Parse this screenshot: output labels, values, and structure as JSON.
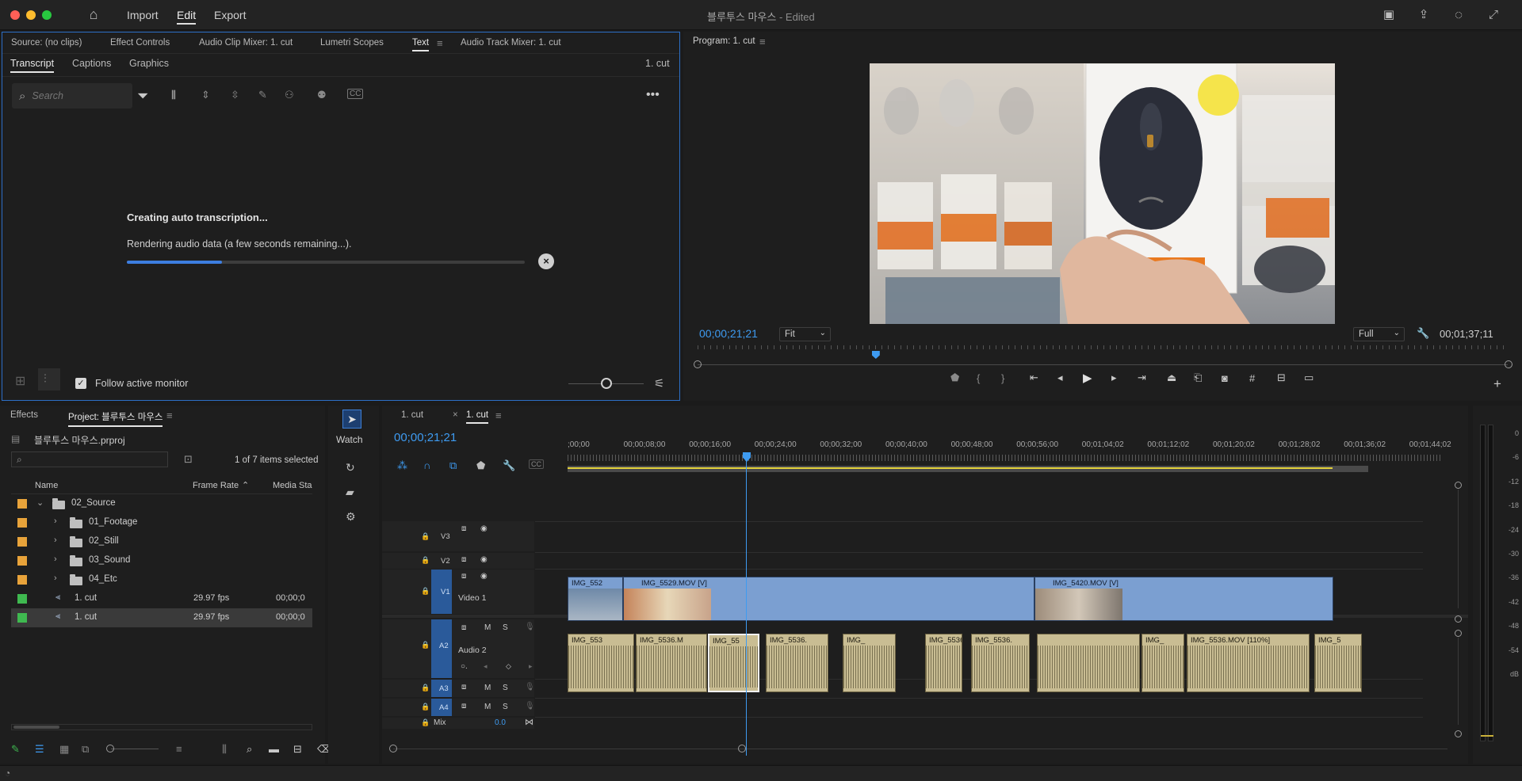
{
  "app": {
    "title": "블루투스 마우스",
    "title_suffix": " - Edited"
  },
  "menu": {
    "import": "Import",
    "edit": "Edit",
    "export": "Export"
  },
  "source_panel": {
    "tabs": [
      "Source: (no clips)",
      "Effect Controls",
      "Audio Clip Mixer: 1. cut",
      "Lumetri Scopes",
      "Text",
      "Audio Track Mixer: 1. cut"
    ],
    "subtabs": [
      "Transcript",
      "Captions",
      "Graphics"
    ],
    "sequence_label": "1. cut",
    "search_placeholder": "Search",
    "status_title": "Creating auto transcription...",
    "status_detail": "Rendering audio data (a few seconds remaining...).",
    "progress": 0.24,
    "follow_label": "Follow active monitor"
  },
  "program": {
    "title": "Program: 1. cut",
    "timecode": "00;00;21;21",
    "fit": "Fit",
    "quality": "Full",
    "duration": "00;01;37;11",
    "playhead_fraction": 0.22
  },
  "project": {
    "tabs": [
      "Effects",
      "Project: 블루투스 마우스"
    ],
    "file": "블루투스 마우스.prproj",
    "selection": "1 of 7 items selected",
    "columns": [
      "Name",
      "Frame Rate",
      "Media Star"
    ],
    "items": [
      {
        "name": "02_Source",
        "type": "folder",
        "color": "#e8a33a",
        "indent": 0,
        "expanded": true,
        "fps": "",
        "start": ""
      },
      {
        "name": "01_Footage",
        "type": "folder",
        "color": "#e8a33a",
        "indent": 1,
        "expanded": false,
        "fps": "",
        "start": ""
      },
      {
        "name": "02_Still",
        "type": "folder",
        "color": "#e8a33a",
        "indent": 1,
        "expanded": false,
        "fps": "",
        "start": ""
      },
      {
        "name": "03_Sound",
        "type": "folder",
        "color": "#e8a33a",
        "indent": 1,
        "expanded": false,
        "fps": "",
        "start": ""
      },
      {
        "name": "04_Etc",
        "type": "folder",
        "color": "#e8a33a",
        "indent": 1,
        "expanded": false,
        "fps": "",
        "start": ""
      },
      {
        "name": "1. cut",
        "type": "sequence",
        "color": "#3fb950",
        "indent": 0,
        "fps": "29.97 fps",
        "start": "00;00;0"
      },
      {
        "name": "1. cut",
        "type": "sequence",
        "color": "#3fb950",
        "indent": 0,
        "fps": "29.97 fps",
        "start": "00;00;0",
        "selected": true
      }
    ]
  },
  "tools": {
    "watch": "Watch"
  },
  "timeline": {
    "tabs": [
      "1. cut",
      "1. cut"
    ],
    "timecode": "00;00;21;21",
    "ruler": [
      ";00;00",
      "00;00;08;00",
      "00;00;16;00",
      "00;00;24;00",
      "00;00;32;00",
      "00;00;40;00",
      "00;00;48;00",
      "00;00;56;00",
      "00;01;04;02",
      "00;01;12;02",
      "00;01;20;02",
      "00;01;28;02",
      "00;01;36;02",
      "00;01;44;02"
    ],
    "tracks": {
      "v3": "V3",
      "v2": "V2",
      "v1": "V1",
      "v1_name": "Video 1",
      "a2": "A2",
      "a2_name": "Audio 2",
      "a3": "A3",
      "a4": "A4",
      "mix": "Mix",
      "mix_val": "0.0"
    },
    "video_clips": [
      "IMG_552",
      "IMG_5529.MOV [V]",
      "IMG_5420.MOV [V]"
    ],
    "audio_clips": [
      "IMG_553",
      "IMG_5536.M",
      "IMG_55",
      "IMG_5536.",
      "IMG_",
      "IMG_5536.",
      "IMG_5536.",
      "IMG_",
      "IMG_5536.MOV [110%]",
      "IMG_5"
    ],
    "meter": [
      "0",
      "-6",
      "-12",
      "-18",
      "-24",
      "-30",
      "-36",
      "-42",
      "-48",
      "-54",
      "dB"
    ],
    "track_buttons": {
      "m": "M",
      "s": "S"
    }
  }
}
